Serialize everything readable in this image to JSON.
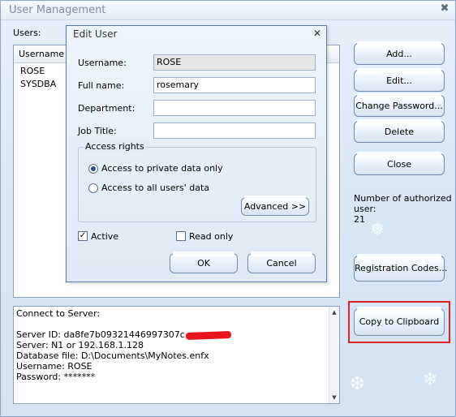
{
  "window": {
    "title": "User Management",
    "close_glyph": "✖"
  },
  "users": {
    "label": "Users:",
    "column": "Username",
    "rows": [
      "ROSE",
      "SYSDBA"
    ]
  },
  "buttons": {
    "add": "Add...",
    "edit": "Edit...",
    "change_password": "Change Password...",
    "delete": "Delete",
    "close": "Close",
    "registration_codes": "Registration Codes...",
    "copy_to_clipboard": "Copy to Clipboard"
  },
  "authorized": {
    "label_line1": "Number of authorized",
    "label_line2": "user:",
    "count": "21"
  },
  "connection_info": {
    "heading": "Connect to Server:",
    "server_id": "Server ID: da8fe7b09321446997307c",
    "server": "Server: N1 or 192.168.1.128",
    "database_file": "Database file: D:\\Documents\\MyNotes.enfx",
    "username": "Username: ROSE",
    "password": "Password: *******"
  },
  "edit_user": {
    "title": "Edit User",
    "close_glyph": "✕",
    "username_label": "Username:",
    "username_value": "ROSE",
    "fullname_label": "Full name:",
    "fullname_value": "rosemary",
    "department_label": "Department:",
    "department_value": "",
    "jobtitle_label": "Job Title:",
    "jobtitle_value": "",
    "access_rights_label": "Access rights",
    "option_private": "Access to private data only",
    "option_all": "Access to all users' data",
    "selected_option": "private",
    "advanced": "Advanced >>",
    "active_label": "Active",
    "active_checked": true,
    "readonly_label": "Read only",
    "readonly_checked": false,
    "ok": "OK",
    "cancel": "Cancel"
  },
  "colors": {
    "highlight": "#e02020",
    "redaction": "#e8151d"
  }
}
